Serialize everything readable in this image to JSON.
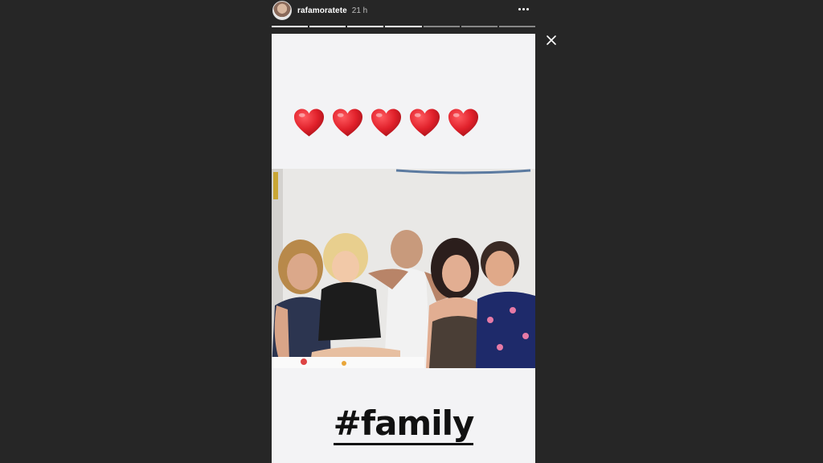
{
  "header": {
    "username": "rafamoratete",
    "timestamp": "21 h"
  },
  "progress": {
    "segments": 7,
    "completed": 4
  },
  "story": {
    "hearts": [
      "heart-emoji",
      "heart-emoji",
      "heart-emoji",
      "heart-emoji",
      "heart-emoji"
    ],
    "hashtag": "#family"
  },
  "colors": {
    "background": "#262626",
    "heart": "#e0202a",
    "hashtag": "#111111"
  }
}
